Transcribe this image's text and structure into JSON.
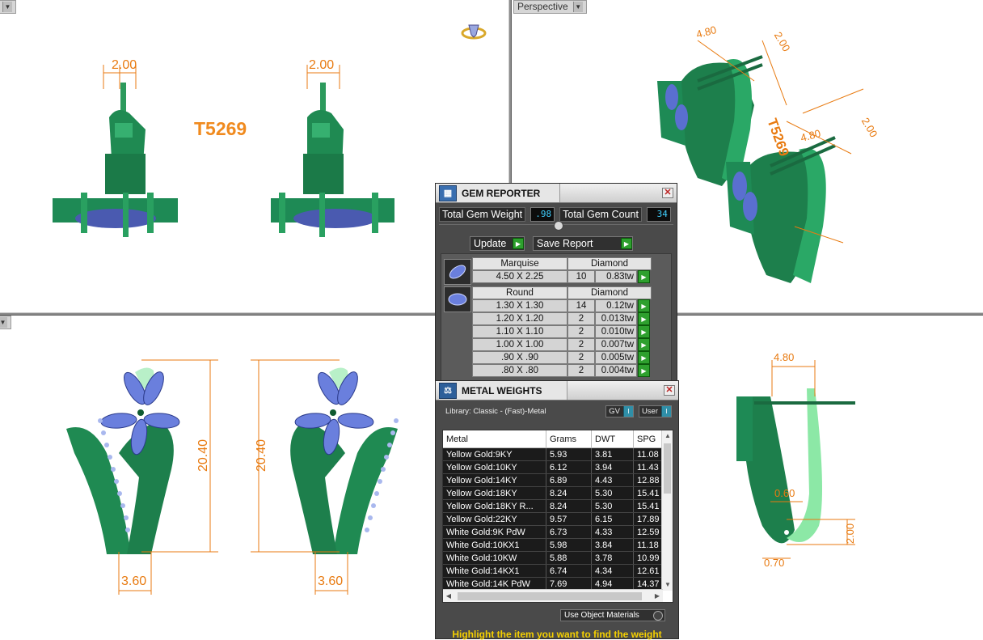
{
  "viewports": {
    "top_right_label": "Perspective"
  },
  "model": {
    "code": "T5269",
    "dimensions": {
      "post_width_left": "2.00",
      "post_width_right": "2.00",
      "height_left": "20.40",
      "height_right": "20.40",
      "base_left": "3.60",
      "base_right": "3.60",
      "side_top": "4.80",
      "side_mid": "0.60",
      "side_right": "2.00",
      "side_bottom": "0.70",
      "persp_a": "4.80",
      "persp_b": "2.00",
      "persp_c": "4.80",
      "persp_d": "2.00"
    }
  },
  "gem_reporter": {
    "title": "GEM REPORTER",
    "total_weight_label": "Total Gem Weight",
    "total_weight_value": ".98",
    "total_count_label": "Total Gem Count",
    "total_count_value": "34",
    "update_label": "Update",
    "save_report_label": "Save Report",
    "groups": [
      {
        "shape": "Marquise",
        "type": "Diamond",
        "rows": [
          {
            "size": "4.50 X 2.25",
            "count": "10",
            "weight": "0.83tw"
          }
        ]
      },
      {
        "shape": "Round",
        "type": "Diamond",
        "rows": [
          {
            "size": "1.30 X 1.30",
            "count": "14",
            "weight": "0.12tw"
          },
          {
            "size": "1.20 X 1.20",
            "count": "2",
            "weight": "0.013tw"
          },
          {
            "size": "1.10 X 1.10",
            "count": "2",
            "weight": "0.010tw"
          },
          {
            "size": "1.00 X 1.00",
            "count": "2",
            "weight": "0.007tw"
          },
          {
            "size": ".90 X .90",
            "count": "2",
            "weight": "0.005tw"
          },
          {
            "size": ".80 X .80",
            "count": "2",
            "weight": "0.004tw"
          }
        ]
      }
    ]
  },
  "metal_weights": {
    "title": "METAL WEIGHTS",
    "library": "Library: Classic - (Fast)-Metal",
    "gv_label": "GV",
    "user_label": "User",
    "columns": [
      "Metal",
      "Grams",
      "DWT",
      "SPG"
    ],
    "rows": [
      [
        "Yellow Gold:9KY",
        "5.93",
        "3.81",
        "11.08"
      ],
      [
        "Yellow Gold:10KY",
        "6.12",
        "3.94",
        "11.43"
      ],
      [
        "Yellow Gold:14KY",
        "6.89",
        "4.43",
        "12.88"
      ],
      [
        "Yellow Gold:18KY",
        "8.24",
        "5.30",
        "15.41"
      ],
      [
        "Yellow Gold:18KY R...",
        "8.24",
        "5.30",
        "15.41"
      ],
      [
        "Yellow Gold:22KY",
        "9.57",
        "6.15",
        "17.89"
      ],
      [
        "White Gold:9K PdW",
        "6.73",
        "4.33",
        "12.59"
      ],
      [
        "White Gold:10KX1",
        "5.98",
        "3.84",
        "11.18"
      ],
      [
        "White Gold:10KW",
        "5.88",
        "3.78",
        "10.99"
      ],
      [
        "White Gold:14KX1",
        "6.74",
        "4.34",
        "12.61"
      ],
      [
        "White Gold:14K PdW",
        "7.69",
        "4.94",
        "14.37"
      ]
    ],
    "use_object_materials": "Use Object Materials",
    "hint": "Highlight the item you want to find the weight"
  },
  "colors": {
    "metal_green": "#1e8a55",
    "gem_blue": "#5a6fd0",
    "dim_orange": "#e87a10",
    "panel_bg": "#4a4a4a"
  }
}
